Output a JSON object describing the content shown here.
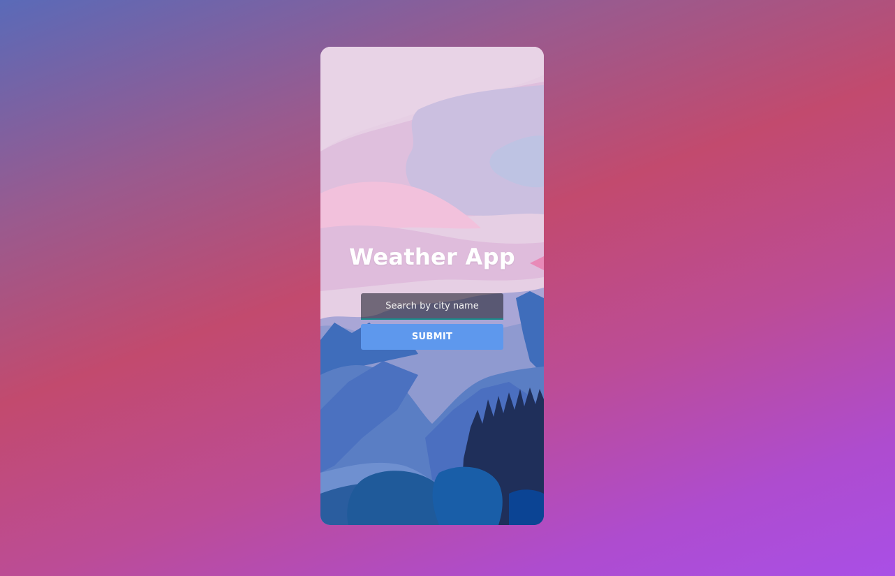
{
  "app": {
    "title": "Weather App"
  },
  "search": {
    "placeholder": "Search by city name",
    "value": ""
  },
  "submit": {
    "label": "SUBMIT"
  },
  "background": {
    "illustration": "mountain-landscape"
  },
  "colors": {
    "submit_button": "#5e98ed",
    "input_underline": "#1a8a8a",
    "page_gradient_start": "#5a6ab8",
    "page_gradient_end": "#a94fe6"
  }
}
